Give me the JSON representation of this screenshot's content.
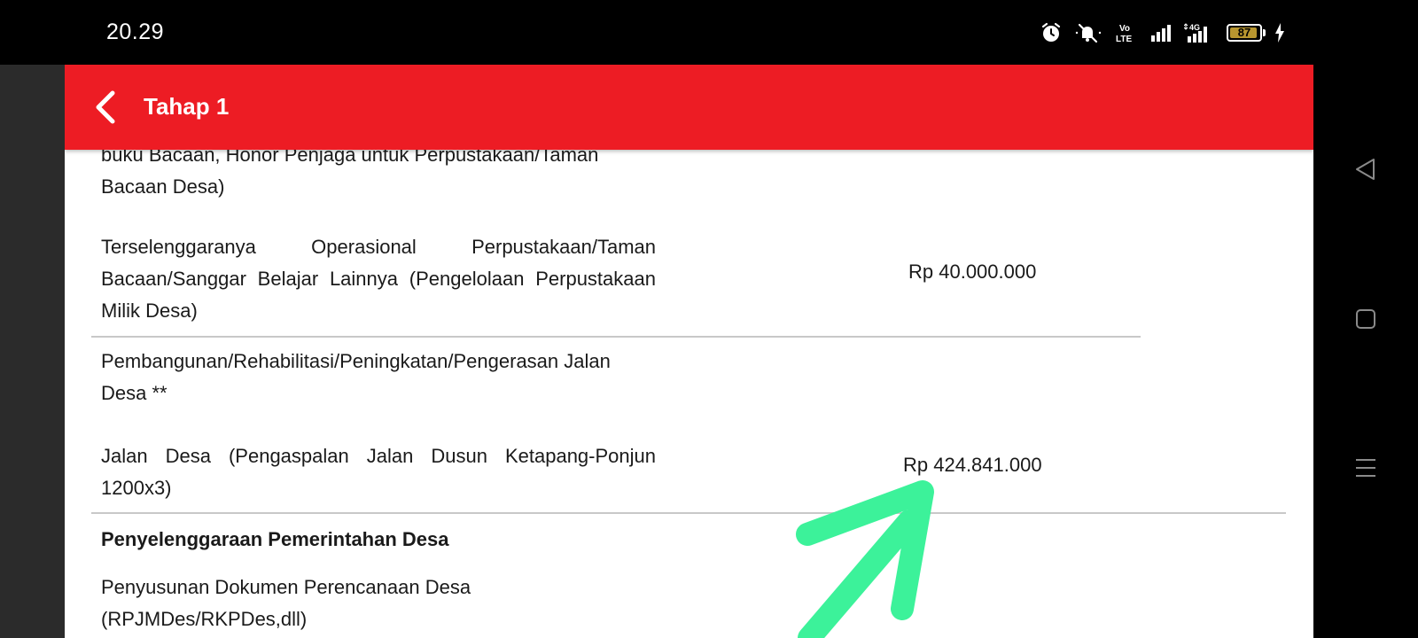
{
  "status_bar": {
    "time": "20.29",
    "icons": [
      "alarm-icon",
      "mute-icon",
      "volte-icon",
      "signal-icon",
      "4g-signal-icon",
      "battery-icon",
      "charging-icon"
    ],
    "volte_label": "Vo\nLTE",
    "network_label": "4G",
    "battery_level": "87"
  },
  "header": {
    "title": "Tahap 1",
    "back_icon": "chevron-left-icon",
    "color": "#ed1c24"
  },
  "content": {
    "item1_cut_line": "buku Bacaan, Honor Penjaga untuk Perpustakaan/Taman",
    "item1_line2": "Bacaan Desa)",
    "item2_text": "Terselenggaranya Operasional Perpustakaan/Taman Bacaan/Sanggar Belajar Lainnya (Pengelolaan Perpustakaan Milik Desa)",
    "item2_amount": "Rp 40.000.000",
    "item3_heading": "Pembangunan/Rehabilitasi/Peningkatan/Pengerasan Jalan Desa **",
    "item3_text": "Jalan Desa (Pengaspalan Jalan Dusun Ketapang-Ponjun 1200x3)",
    "item3_amount": "Rp 424.841.000",
    "section_title": "Penyelenggaraan Pemerintahan Desa",
    "item4_text": "Penyusunan Dokumen Perencanaan Desa (RPJMDes/RKPDes,dll)"
  },
  "annotation": {
    "arrow_color": "#3cf29a"
  },
  "nav_bar": {
    "icons": [
      "back-triangle-icon",
      "home-square-icon",
      "menu-lines-icon"
    ]
  }
}
